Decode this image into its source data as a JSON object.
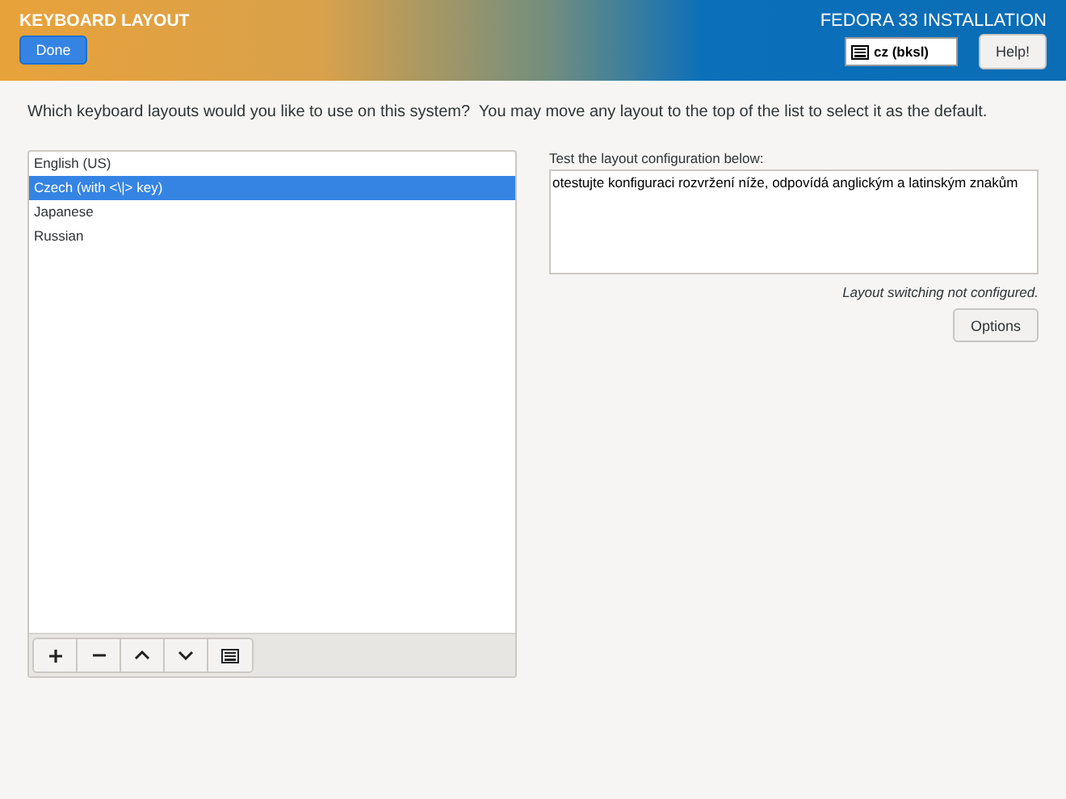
{
  "header": {
    "title": "KEYBOARD LAYOUT",
    "done_button": "Done",
    "product": "FEDORA 33 INSTALLATION",
    "layout_indicator": "cz (bksl)",
    "help_button": "Help!"
  },
  "instructions": "Which keyboard layouts would you like to use on this system?  You may move any layout to the top of the list to select it as the default.",
  "layouts": [
    {
      "label": "English (US)",
      "selected": false
    },
    {
      "label": "Czech (with <\\|> key)",
      "selected": true
    },
    {
      "label": "Japanese",
      "selected": false
    },
    {
      "label": "Russian",
      "selected": false
    }
  ],
  "test": {
    "label": "Test the layout configuration below:",
    "value": "otestujte konfiguraci rozvržení níže, odpovídá anglickým a latinským znakům",
    "note": "Layout switching not configured.",
    "options_button": "Options"
  }
}
